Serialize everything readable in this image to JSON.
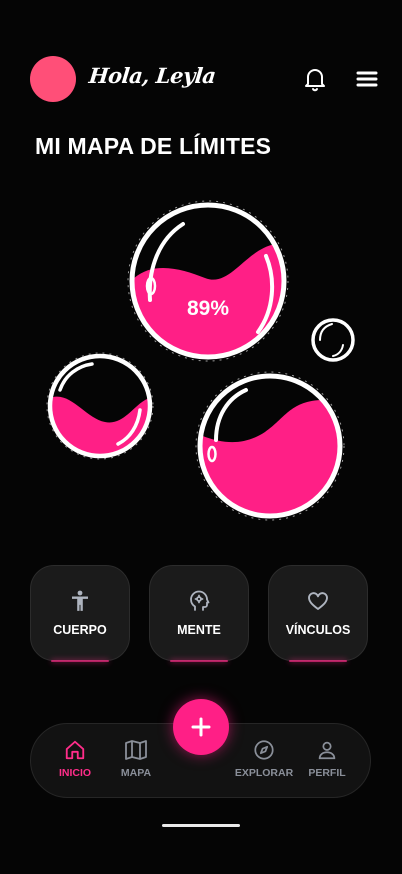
{
  "header": {
    "greeting": "Hola, Leyla",
    "avatar_color": "#ff4f78",
    "icons": [
      "bell-icon",
      "menu-icon"
    ]
  },
  "page_title": "MI MAPA DE LÍMITES",
  "bubbles": {
    "main_percent_label": "89%",
    "fill_color": "#ff1f86",
    "items": [
      {
        "name": "main",
        "fill_level": 0.89
      },
      {
        "name": "left",
        "fill_level": 0.45
      },
      {
        "name": "right",
        "fill_level": 0.55
      },
      {
        "name": "small",
        "fill_level": 0
      }
    ]
  },
  "categories": [
    {
      "label": "CUERPO",
      "icon": "person-icon"
    },
    {
      "label": "MENTE",
      "icon": "head-gear-icon"
    },
    {
      "label": "VÍNCULOS",
      "icon": "heart-icon"
    }
  ],
  "nav": {
    "items": [
      {
        "label": "INICIO",
        "icon": "home-icon",
        "active": true
      },
      {
        "label": "MAPA",
        "icon": "map-icon",
        "active": false
      },
      {
        "label": "EXPLORAR",
        "icon": "compass-icon",
        "active": false
      },
      {
        "label": "PERFIL",
        "icon": "user-icon",
        "active": false
      }
    ],
    "fab_icon": "plus-icon",
    "accent": "#ff2d8a",
    "inactive": "#8a8f99"
  }
}
